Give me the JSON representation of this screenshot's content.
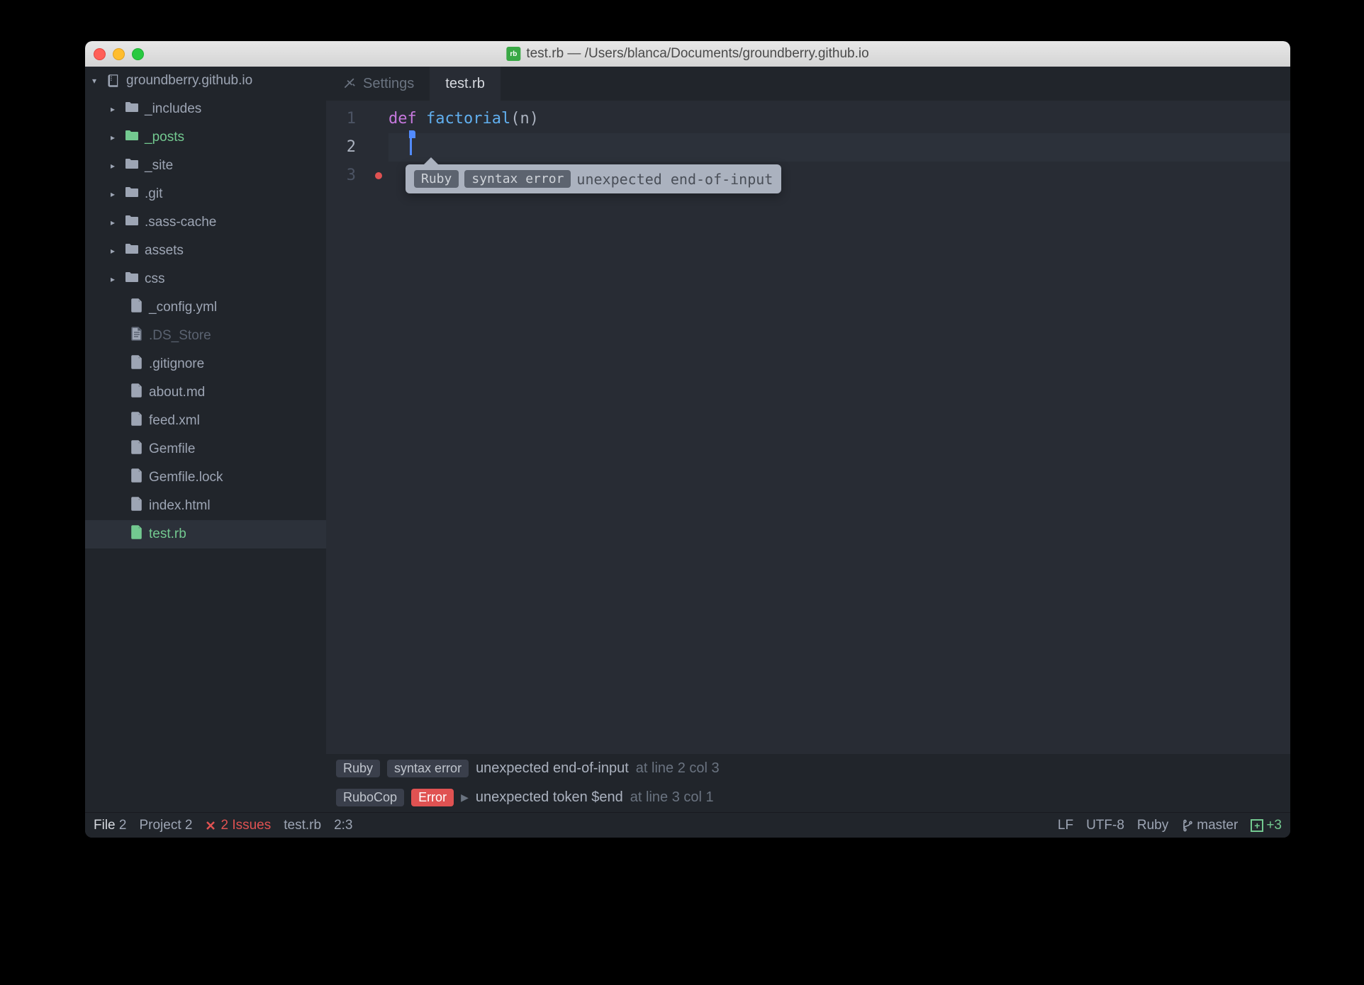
{
  "window_title": "test.rb — /Users/blanca/Documents/groundberry.github.io",
  "sidebar": {
    "project": "groundberry.github.io",
    "items": [
      {
        "label": "_includes",
        "type": "folder"
      },
      {
        "label": "_posts",
        "type": "folder",
        "green": true
      },
      {
        "label": "_site",
        "type": "folder"
      },
      {
        "label": ".git",
        "type": "folder"
      },
      {
        "label": ".sass-cache",
        "type": "folder"
      },
      {
        "label": "assets",
        "type": "folder"
      },
      {
        "label": "css",
        "type": "folder"
      },
      {
        "label": "_config.yml",
        "type": "file"
      },
      {
        "label": ".DS_Store",
        "type": "file",
        "dim": true
      },
      {
        "label": ".gitignore",
        "type": "file"
      },
      {
        "label": "about.md",
        "type": "file"
      },
      {
        "label": "feed.xml",
        "type": "file"
      },
      {
        "label": "Gemfile",
        "type": "file"
      },
      {
        "label": "Gemfile.lock",
        "type": "file"
      },
      {
        "label": "index.html",
        "type": "file"
      },
      {
        "label": "test.rb",
        "type": "file",
        "green": true,
        "active": true
      }
    ]
  },
  "tabs": {
    "settings": "Settings",
    "file": "test.rb"
  },
  "code": {
    "line1_kw": "def",
    "line1_fn": "factorial",
    "line1_rest": "(n)",
    "ln1": "1",
    "ln2": "2",
    "ln3": "3"
  },
  "tooltip": {
    "lang": "Ruby",
    "kind": "syntax error",
    "msg": "unexpected end-of-input"
  },
  "linter": {
    "row1": {
      "lang": "Ruby",
      "kind": "syntax error",
      "msg": "unexpected end-of-input",
      "loc": "at line 2 col 3"
    },
    "row2": {
      "lang": "RuboCop",
      "kind": "Error",
      "msg": "unexpected token $end",
      "loc": "at line 3 col 1"
    }
  },
  "status": {
    "file_tab": "File",
    "file_count": "2",
    "project_tab": "Project",
    "project_count": "2",
    "issues": "2 Issues",
    "filename": "test.rb",
    "cursor": "2:3",
    "eol": "LF",
    "encoding": "UTF-8",
    "lang": "Ruby",
    "branch": "master",
    "git_plus": "+3"
  }
}
